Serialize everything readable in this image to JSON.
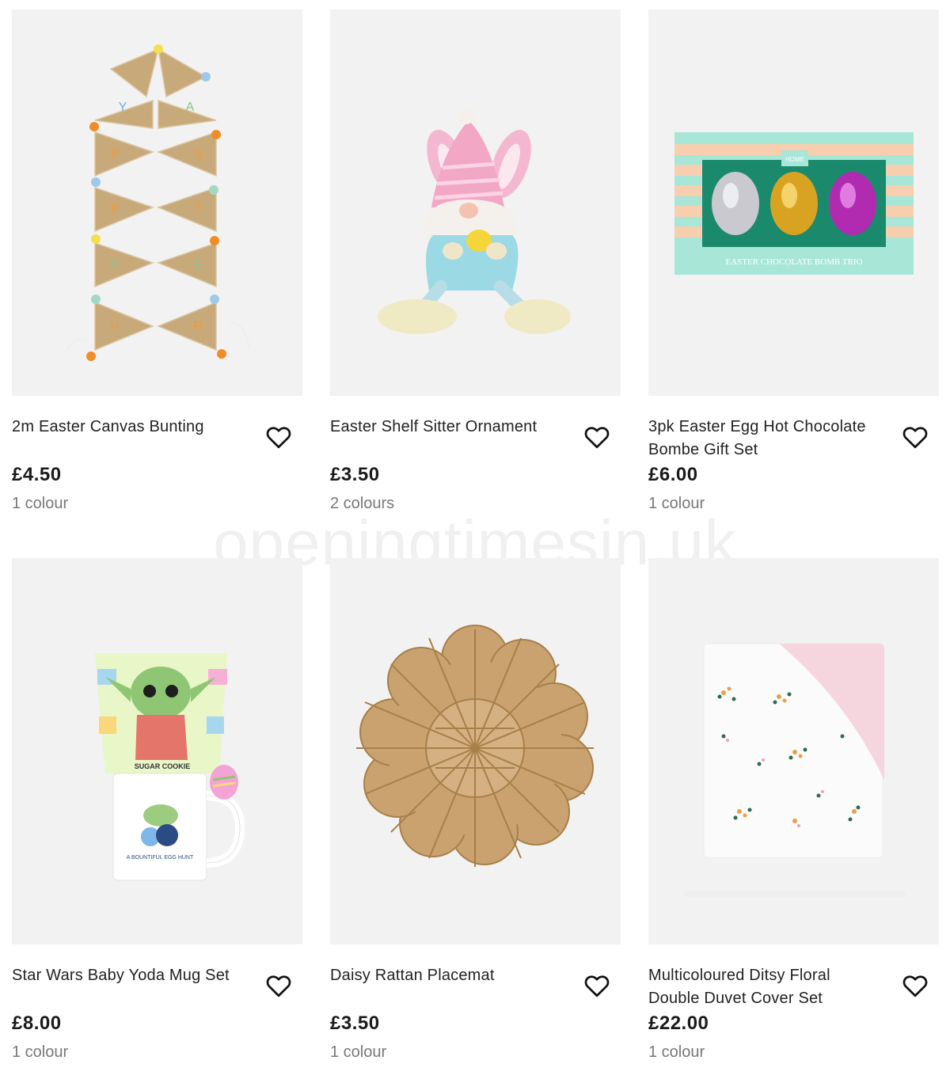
{
  "watermark": "openingtimesin.uk",
  "products": [
    {
      "title": "2m Easter Canvas Bunting",
      "price": "£4.50",
      "colours": "1 colour",
      "image": "bunting"
    },
    {
      "title": "Easter Shelf Sitter Ornament",
      "price": "£3.50",
      "colours": "2 colours",
      "image": "gnome"
    },
    {
      "title": "3pk Easter Egg Hot Chocolate Bombe Gift Set",
      "price": "£6.00",
      "colours": "1 colour",
      "image": "eggs"
    },
    {
      "title": "Star Wars Baby Yoda Mug Set",
      "price": "£8.00",
      "colours": "1 colour",
      "image": "mug"
    },
    {
      "title": "Daisy Rattan Placemat",
      "price": "£3.50",
      "colours": "1 colour",
      "image": "placemat"
    },
    {
      "title": "Multicoloured Ditsy Floral Double Duvet Cover Set",
      "price": "£22.00",
      "colours": "1 colour",
      "image": "duvet"
    }
  ],
  "product_image_text": {
    "bunting_letters": "HAPPY EASTER",
    "eggs_brand": "HOME",
    "eggs_box_label": "EASTER CHOCOLATE BOMB TRIO",
    "mug_label": "SUGAR COOKIE",
    "mug_caption": "A BOUNTIFUL EGG HUNT"
  },
  "icons": {
    "favourite": "heart-outline-icon"
  }
}
